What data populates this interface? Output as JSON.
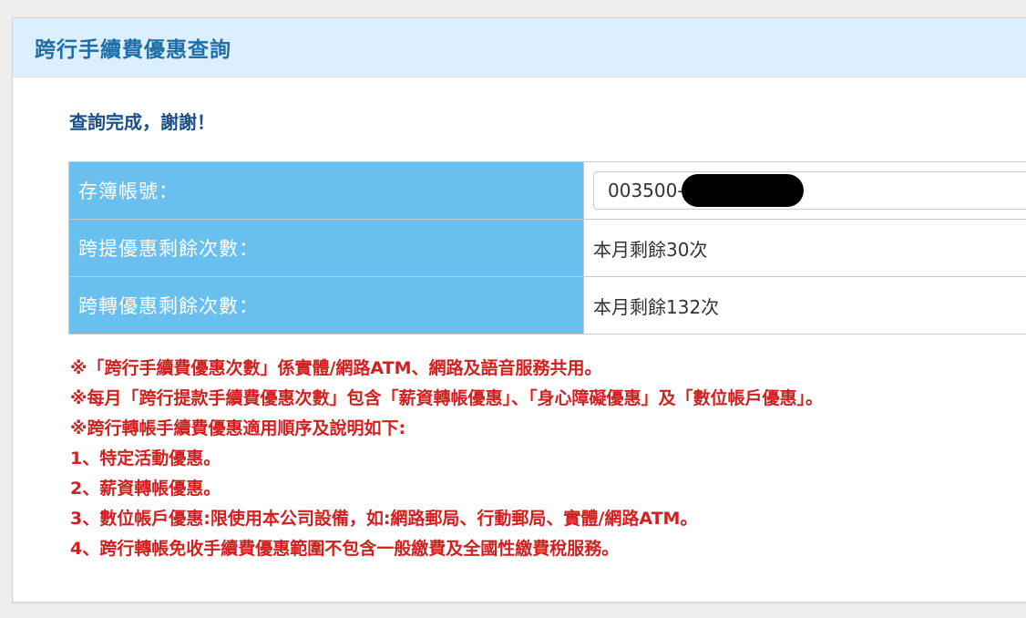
{
  "header": {
    "title": "跨行手續費優惠查詢"
  },
  "status": {
    "message": "查詢完成，謝謝！"
  },
  "table": {
    "rows": [
      {
        "label": "存簿帳號：",
        "value": "003500-7"
      },
      {
        "label": "跨提優惠剩餘次數：",
        "value": "本月剩餘30次"
      },
      {
        "label": "跨轉優惠剩餘次數：",
        "value": "本月剩餘132次"
      }
    ]
  },
  "notes": [
    "※「跨行手續費優惠次數」係實體/網路ATM、網路及語音服務共用。",
    "※每月「跨行提款手續費優惠次數」包含「薪資轉帳優惠」、「身心障礙優惠」及「數位帳戶優惠」。",
    "※跨行轉帳手續費優惠適用順序及說明如下:",
    "1、特定活動優惠。",
    "2、薪資轉帳優惠。",
    "3、數位帳戶優惠:限使用本公司設備，如:網路郵局、行動郵局、實體/網路ATM。",
    "4、跨行轉帳免收手續費優惠範圍不包含一般繳費及全國性繳費稅服務。"
  ]
}
